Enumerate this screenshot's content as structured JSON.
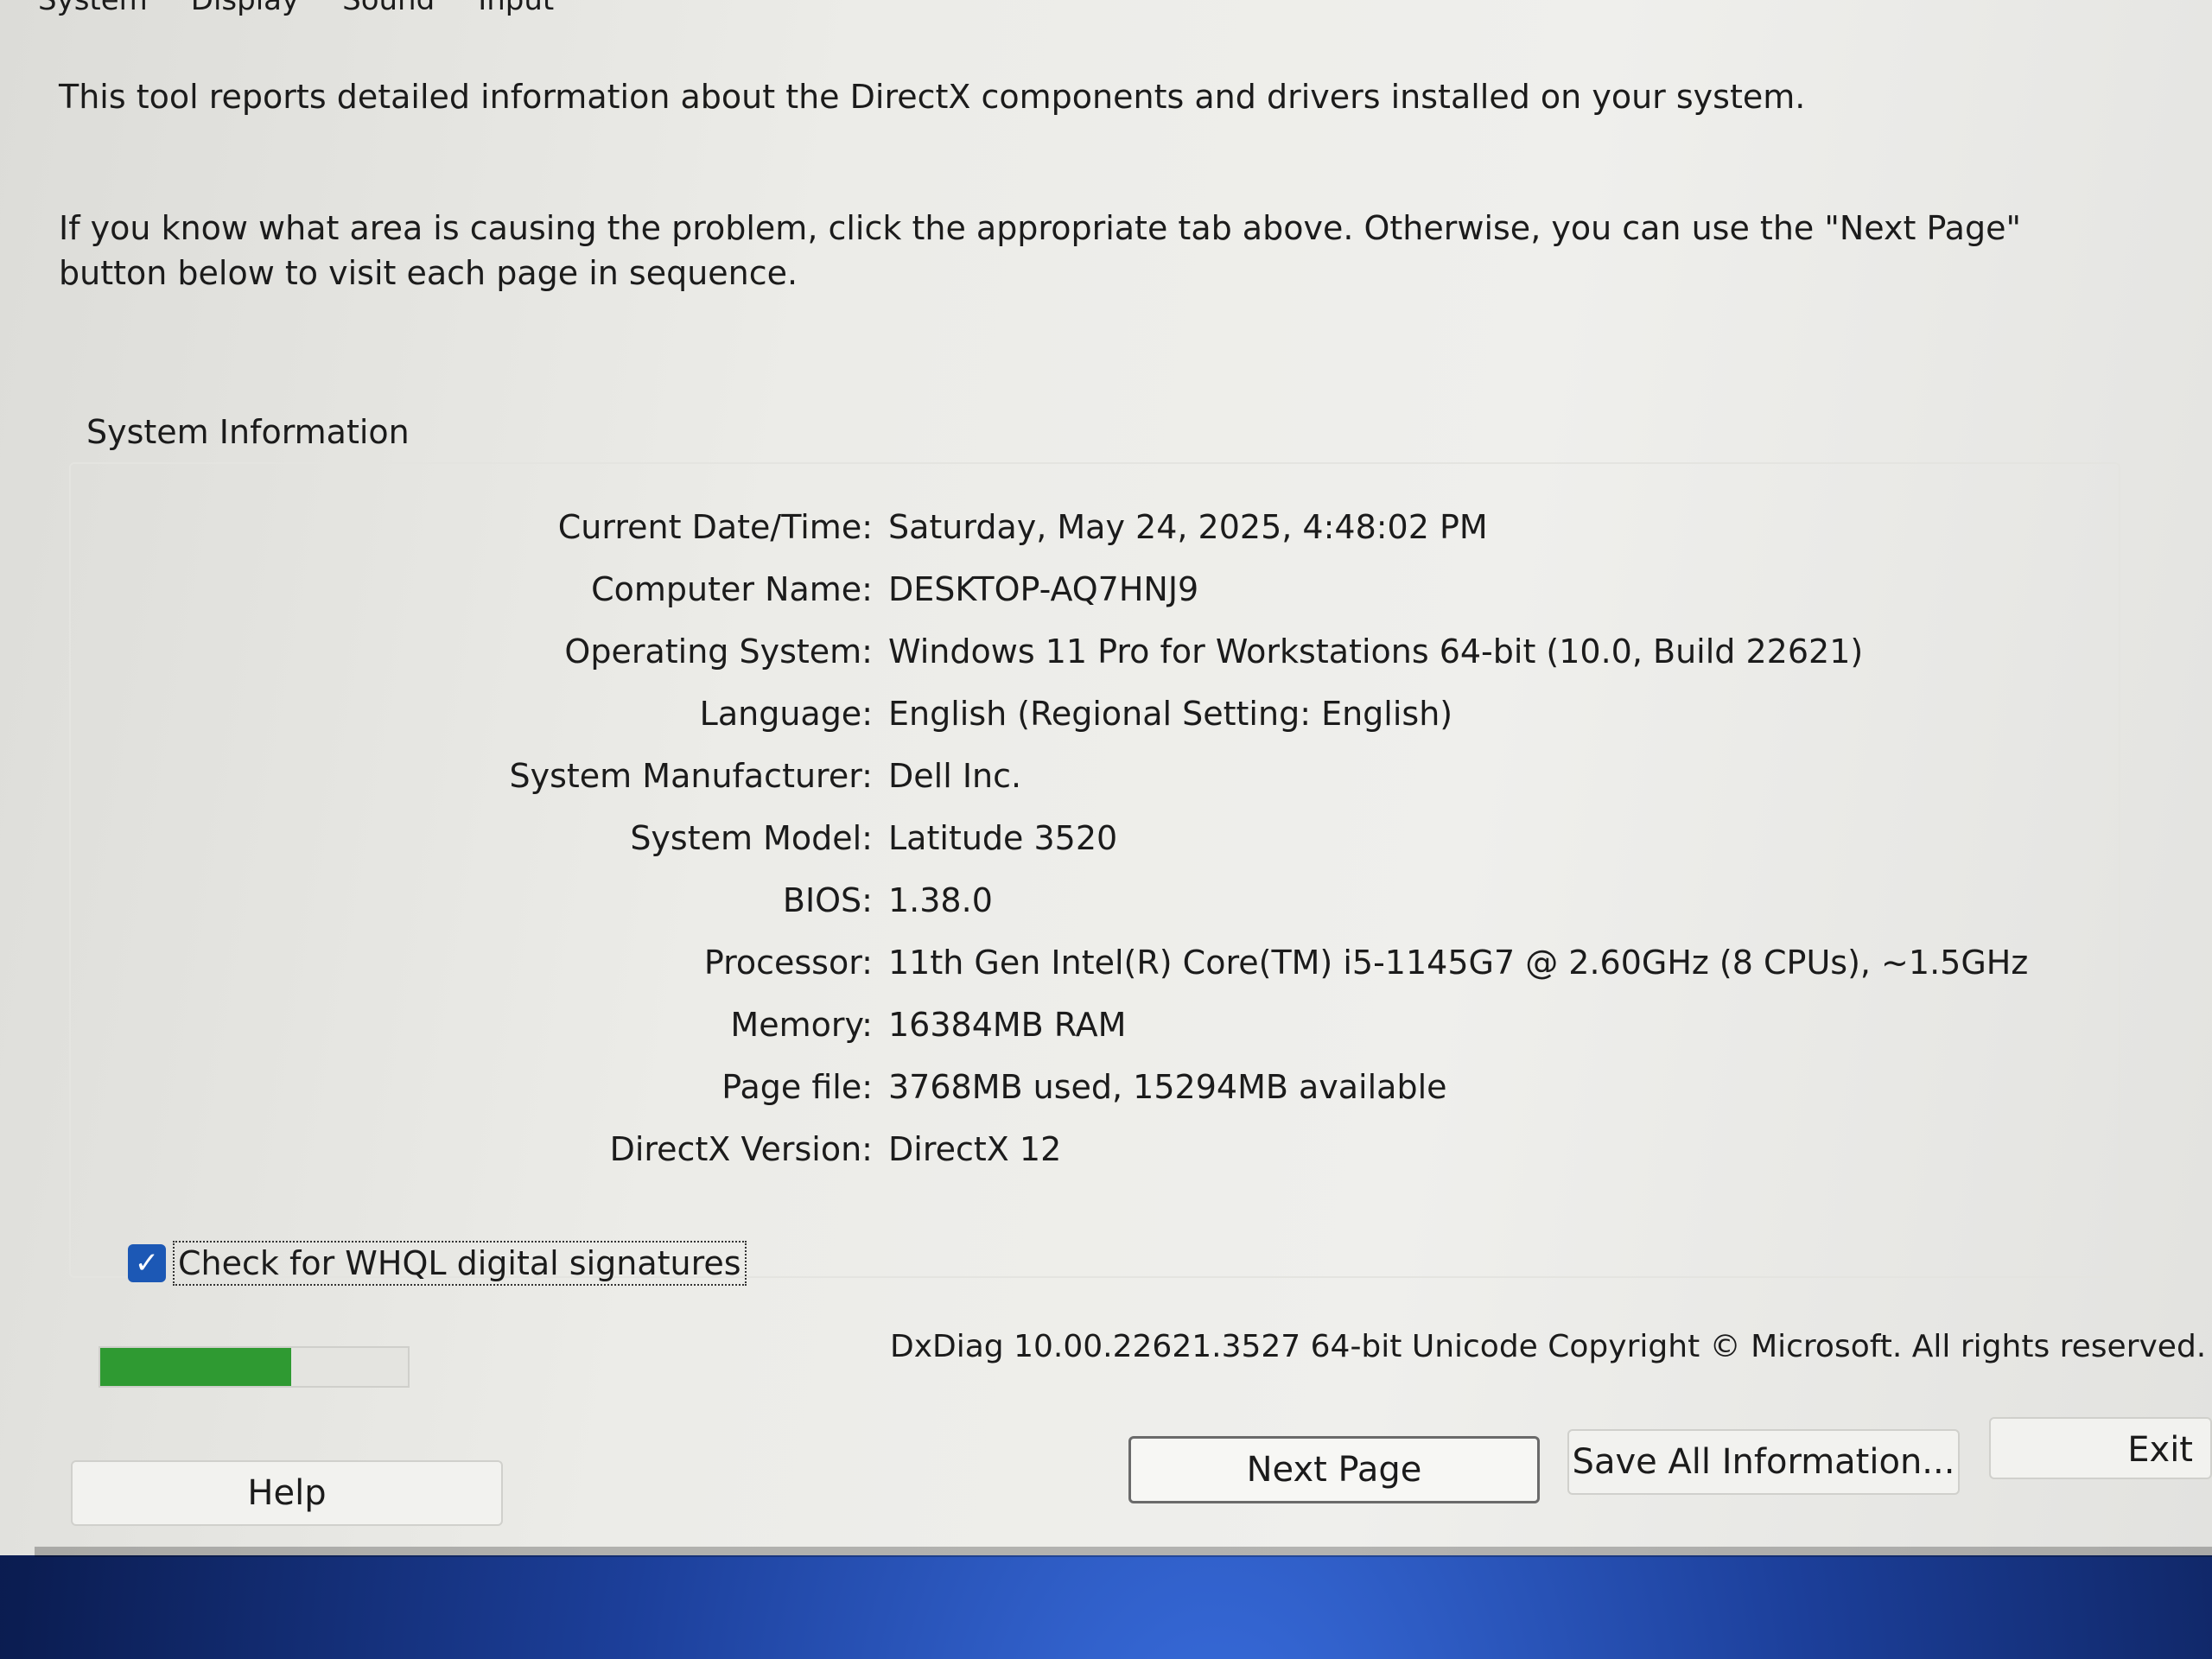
{
  "tabs": [
    "System",
    "Display",
    "Sound",
    "Input"
  ],
  "intro": {
    "line1": "This tool reports detailed information about the DirectX components and drivers installed on your system.",
    "line2": "If you know what area is causing the problem, click the appropriate tab above.  Otherwise, you can use the \"Next Page\" button below to visit each page in sequence."
  },
  "section_title": "System Information",
  "info": [
    {
      "label": "Current Date/Time:",
      "value": "Saturday, May 24, 2025, 4:48:02 PM"
    },
    {
      "label": "Computer Name:",
      "value": "DESKTOP-AQ7HNJ9"
    },
    {
      "label": "Operating System:",
      "value": "Windows 11 Pro for Workstations 64-bit (10.0, Build 22621)"
    },
    {
      "label": "Language:",
      "value": "English (Regional Setting: English)"
    },
    {
      "label": "System Manufacturer:",
      "value": "Dell Inc."
    },
    {
      "label": "System Model:",
      "value": "Latitude 3520"
    },
    {
      "label": "BIOS:",
      "value": "1.38.0"
    },
    {
      "label": "Processor:",
      "value": "11th Gen Intel(R) Core(TM) i5-1145G7 @ 2.60GHz (8 CPUs), ~1.5GHz"
    },
    {
      "label": "Memory:",
      "value": "16384MB RAM"
    },
    {
      "label": "Page file:",
      "value": "3768MB used, 15294MB available"
    },
    {
      "label": "DirectX Version:",
      "value": "DirectX 12"
    }
  ],
  "whql_checkbox": {
    "label": "Check for WHQL digital signatures",
    "checked": true
  },
  "progress": {
    "fraction": 0.62
  },
  "copyright": "DxDiag 10.00.22621.3527 64-bit Unicode  Copyright © Microsoft. All rights reserved.",
  "buttons": {
    "help": "Help",
    "next": "Next Page",
    "save": "Save All Information...",
    "exit": "Exit"
  },
  "colors": {
    "checkbox": "#1c58b5",
    "progress": "#2f9a32"
  }
}
